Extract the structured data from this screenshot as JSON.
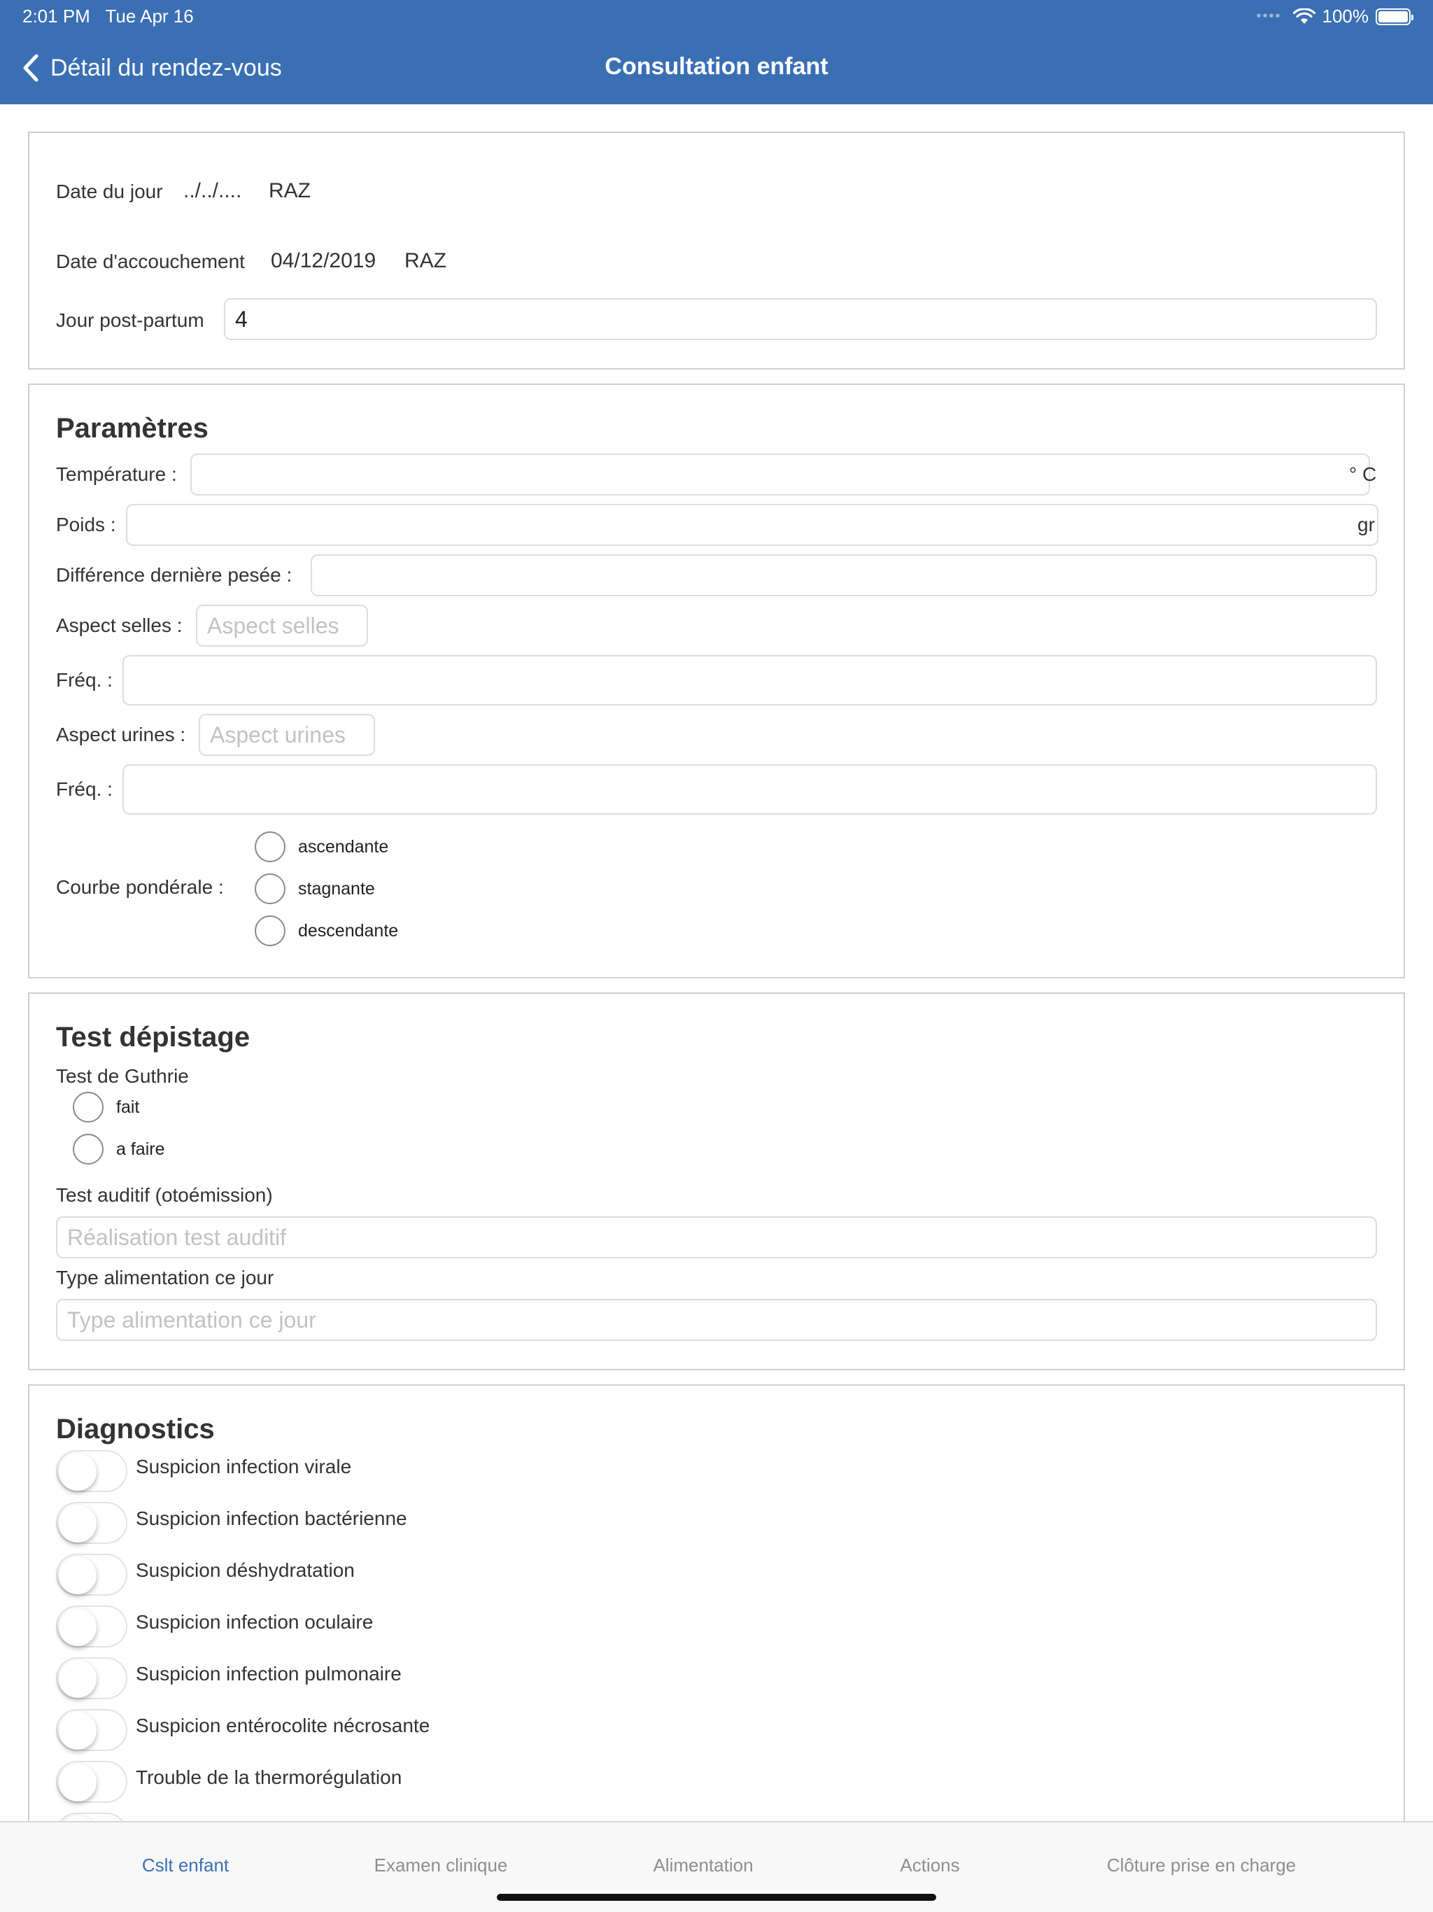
{
  "status_bar": {
    "time": "2:01 PM",
    "date": "Tue Apr 16",
    "battery": "100%"
  },
  "nav": {
    "back_label": "Détail du rendez-vous",
    "title": "Consultation enfant"
  },
  "dates": {
    "date_du_jour_label": "Date du jour",
    "date_du_jour_value": "../../....",
    "raz_label": "RAZ",
    "date_accouchement_label": "Date d'accouchement",
    "date_accouchement_value": "04/12/2019",
    "post_partum_label": "Jour post-partum",
    "post_partum_value": "4"
  },
  "parametres": {
    "title": "Paramètres",
    "temperature_label": "Température :",
    "temperature_unit": "° C",
    "poids_label": "Poids :",
    "poids_unit": "gr",
    "difference_label": "Différence dernière pesée :",
    "selles_label": "Aspect selles :",
    "selles_placeholder": "Aspect selles",
    "freq_label": "Fréq. :",
    "urines_label": "Aspect urines :",
    "urines_placeholder": "Aspect urines",
    "courbe_label": "Courbe pondérale :",
    "courbe_options": [
      "ascendante",
      "stagnante",
      "descendante"
    ]
  },
  "depistage": {
    "title": "Test dépistage",
    "guthrie_label": "Test de Guthrie",
    "guthrie_options": [
      "fait",
      "a faire"
    ],
    "auditif_label": "Test auditif (otoémission)",
    "auditif_placeholder": "Réalisation test auditif",
    "alimentation_label": "Type alimentation ce jour",
    "alimentation_placeholder": "Type alimentation ce jour"
  },
  "diagnostics": {
    "title": "Diagnostics",
    "items": [
      "Suspicion infection virale",
      "Suspicion infection bactérienne",
      "Suspicion déshydratation",
      "Suspicion infection oculaire",
      "Suspicion infection pulmonaire",
      "Suspicion entérocolite nécrosante",
      "Trouble de la thermorégulation"
    ]
  },
  "tabs": [
    "Cslt enfant",
    "Examen clinique",
    "Alimentation",
    "Actions",
    "Clôture prise en charge"
  ],
  "colors": {
    "primary": "#3b6fb4",
    "inactive_tab": "#8e8e8e"
  }
}
